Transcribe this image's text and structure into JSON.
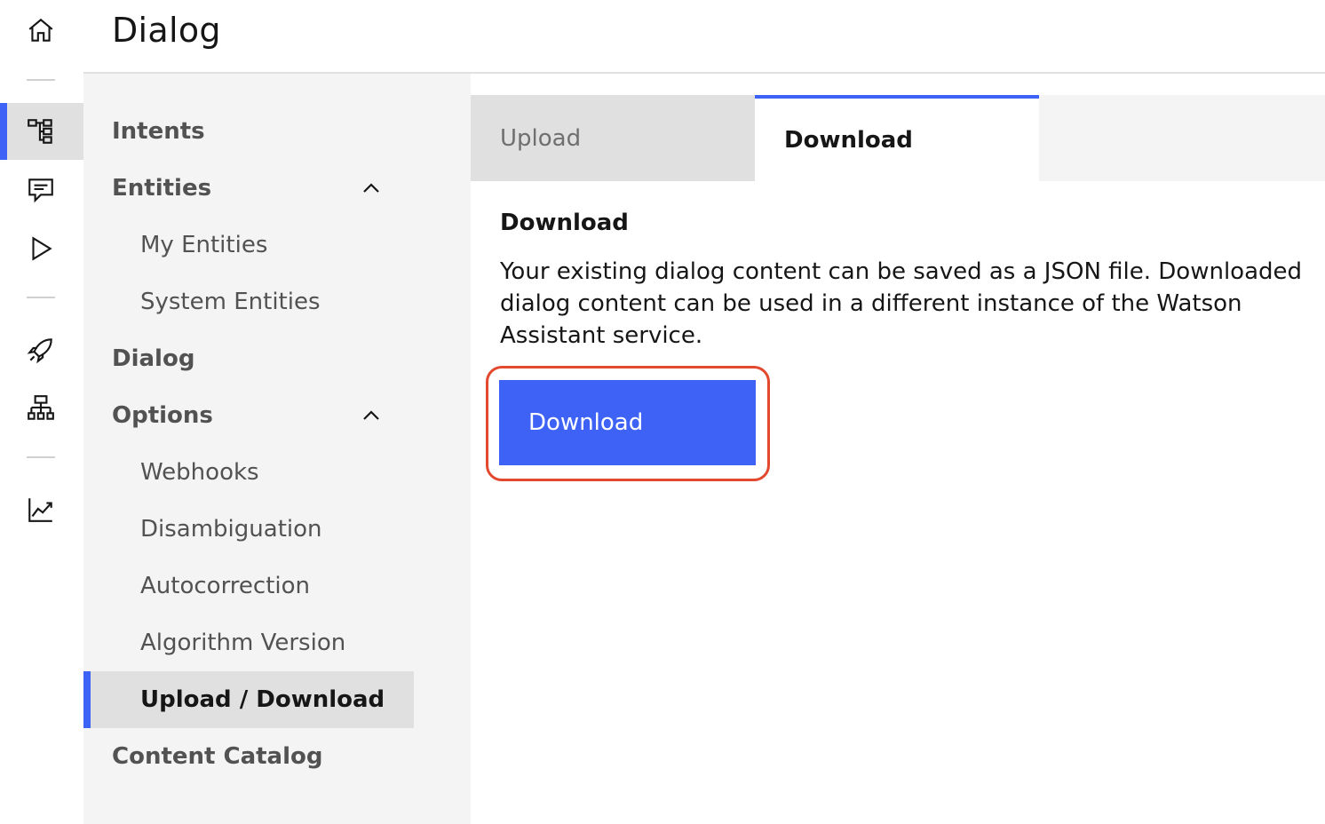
{
  "header": {
    "title": "Dialog"
  },
  "rail": {
    "icons": [
      "home-icon",
      "dialog-tree-icon",
      "chat-icon",
      "play-icon",
      "rocket-icon",
      "integrations-icon",
      "analytics-icon"
    ],
    "accent": "#3d62f5"
  },
  "nav": {
    "items": [
      {
        "label": "Intents",
        "level": "top"
      },
      {
        "label": "Entities",
        "level": "top",
        "expanded": true
      },
      {
        "label": "My Entities",
        "level": "sub"
      },
      {
        "label": "System Entities",
        "level": "sub"
      },
      {
        "label": "Dialog",
        "level": "top"
      },
      {
        "label": "Options",
        "level": "top",
        "expanded": true
      },
      {
        "label": "Webhooks",
        "level": "sub"
      },
      {
        "label": "Disambiguation",
        "level": "sub"
      },
      {
        "label": "Autocorrection",
        "level": "sub"
      },
      {
        "label": "Algorithm Version",
        "level": "sub"
      },
      {
        "label": "Upload / Download",
        "level": "sub",
        "selected": true
      },
      {
        "label": "Content Catalog",
        "level": "top"
      }
    ]
  },
  "tabs": [
    {
      "label": "Upload",
      "active": false
    },
    {
      "label": "Download",
      "active": true
    }
  ],
  "content": {
    "title": "Download",
    "description": "Your existing dialog content can be saved as a JSON file. Downloaded dialog content can be used in a different instance of the Watson Assistant service.",
    "button_label": "Download"
  },
  "colors": {
    "accent": "#3d62f5",
    "highlight": "#e3492e"
  }
}
